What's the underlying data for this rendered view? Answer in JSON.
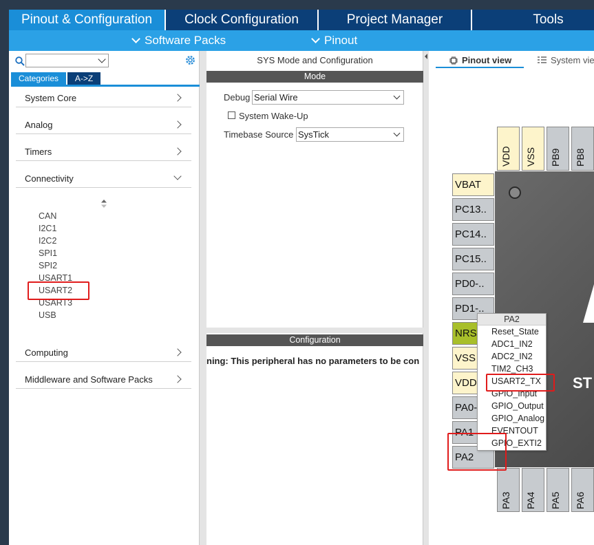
{
  "top_tabs": [
    "Pinout & Configuration",
    "Clock Configuration",
    "Project Manager",
    "Tools"
  ],
  "sub_menu": [
    "Software Packs",
    "Pinout"
  ],
  "left": {
    "search_value": "",
    "tabs": [
      "Categories",
      "A->Z"
    ],
    "categories": [
      "System Core",
      "Analog",
      "Timers",
      "Connectivity",
      "Computing",
      "Middleware and Software Packs"
    ],
    "connectivity_items": [
      "CAN",
      "I2C1",
      "I2C2",
      "SPI1",
      "SPI2",
      "USART1",
      "USART2",
      "USART3",
      "USB"
    ]
  },
  "middle": {
    "title": "SYS Mode and Configuration",
    "mode_header": "Mode",
    "debug_label": "Debug",
    "debug_value": "Serial Wire",
    "wakeup_label": "System Wake-Up",
    "timebase_label": "Timebase Source",
    "timebase_value": "SysTick",
    "config_header": "Configuration",
    "warning": "ning: This peripheral has no parameters to be con"
  },
  "right": {
    "view_tabs": [
      "Pinout view",
      "System vie"
    ],
    "top_pins": [
      "VDD",
      "VSS",
      "PB9",
      "PB8"
    ],
    "left_pins": [
      "VBAT",
      "PC13..",
      "PC14..",
      "PC15..",
      "PD0-..",
      "PD1-..",
      "NRST",
      "VSS",
      "VDD",
      "PA0-",
      "PA1",
      "PA2"
    ],
    "bottom_pins": [
      "PA3",
      "PA4",
      "PA5",
      "PA6"
    ],
    "chip_text": "ST"
  },
  "popup": {
    "title": "PA2",
    "items": [
      "Reset_State",
      "ADC1_IN2",
      "ADC2_IN2",
      "TIM2_CH3",
      "USART2_TX",
      "GPIO_Input",
      "GPIO_Output",
      "GPIO_Analog",
      "EVENTOUT",
      "GPIO_EXTI2"
    ]
  },
  "colors": {
    "tab_active": "#1a8ed8",
    "tab_inactive": "#0b3f78",
    "highlight": "#e01b1b",
    "pin_power": "#fdf4cb",
    "pin_nrst": "#a8bf2a"
  }
}
